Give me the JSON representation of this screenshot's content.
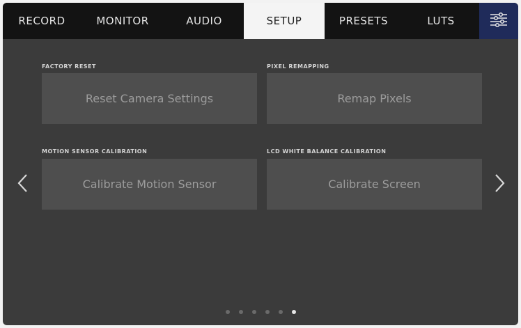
{
  "tabs": [
    {
      "label": "RECORD"
    },
    {
      "label": "MONITOR"
    },
    {
      "label": "AUDIO"
    },
    {
      "label": "SETUP",
      "active": true
    },
    {
      "label": "PRESETS"
    },
    {
      "label": "LUTS"
    }
  ],
  "menu_icon": "sliders-icon",
  "sections": [
    {
      "label": "FACTORY RESET",
      "button": "Reset Camera Settings"
    },
    {
      "label": "PIXEL REMAPPING",
      "button": "Remap Pixels"
    },
    {
      "label": "MOTION SENSOR CALIBRATION",
      "button": "Calibrate Motion Sensor"
    },
    {
      "label": "LCD WHITE BALANCE CALIBRATION",
      "button": "Calibrate Screen"
    }
  ],
  "pagination": {
    "total": 6,
    "current": 6
  },
  "colors": {
    "accent_menu": "#1f2b5a",
    "tab_bar": "#131313",
    "active_tab": "#f4f4f4",
    "background": "#3b3b3b",
    "button": "#4e4e4e"
  }
}
